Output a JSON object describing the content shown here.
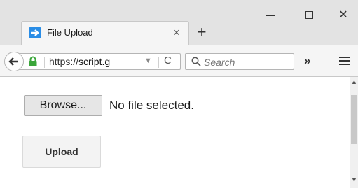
{
  "tab": {
    "title": "File Upload",
    "favicon": "arrow-right-icon",
    "close_label": "×",
    "new_tab_label": "+"
  },
  "window_controls": {
    "close_label": "✕"
  },
  "toolbar": {
    "url_scheme": "https://",
    "url_host": "script.g",
    "dropmark": "▼",
    "reload_label": "C",
    "search_placeholder": "Search",
    "overflow_label": "»"
  },
  "content": {
    "browse_label": "Browse...",
    "file_status": "No file selected.",
    "upload_label": "Upload"
  },
  "colors": {
    "favicon": "#2a8de6",
    "lock": "#3aa63a"
  }
}
